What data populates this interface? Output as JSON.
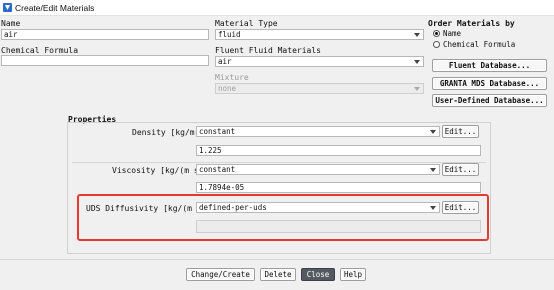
{
  "window": {
    "title": "Create/Edit Materials"
  },
  "name": {
    "label": "Name",
    "value": "air"
  },
  "chemical_formula": {
    "label": "Chemical Formula",
    "value": ""
  },
  "material_type": {
    "label": "Material Type",
    "value": "fluid"
  },
  "fluent_fluid_materials": {
    "label": "Fluent Fluid Materials",
    "value": "air"
  },
  "mixture": {
    "label": "Mixture",
    "value": "none"
  },
  "order_by": {
    "label": "Order Materials by",
    "options": [
      {
        "label": "Name",
        "selected": true
      },
      {
        "label": "Chemical Formula",
        "selected": false
      }
    ]
  },
  "database_buttons": {
    "fluent": "Fluent Database...",
    "granta": "GRANTA MDS Database...",
    "user_defined": "User-Defined Database..."
  },
  "properties": {
    "label": "Properties",
    "rows": [
      {
        "label": "Density [kg/m³]",
        "method": "constant",
        "value": "1.225",
        "edit": "Edit..."
      },
      {
        "label": "Viscosity [kg/(m s)]",
        "method": "constant",
        "value": "1.7894e-05",
        "edit": "Edit..."
      },
      {
        "label": "UDS Diffusivity [kg/(m s)]",
        "method": "defined-per-uds",
        "value": "",
        "edit": "Edit..."
      }
    ]
  },
  "footer_buttons": {
    "change_create": "Change/Create",
    "delete": "Delete",
    "close": "Close",
    "help": "Help"
  },
  "colors": {
    "highlight": "#e53a2e",
    "close_button": "#555a62",
    "app_icon": "#2b6cc4"
  }
}
